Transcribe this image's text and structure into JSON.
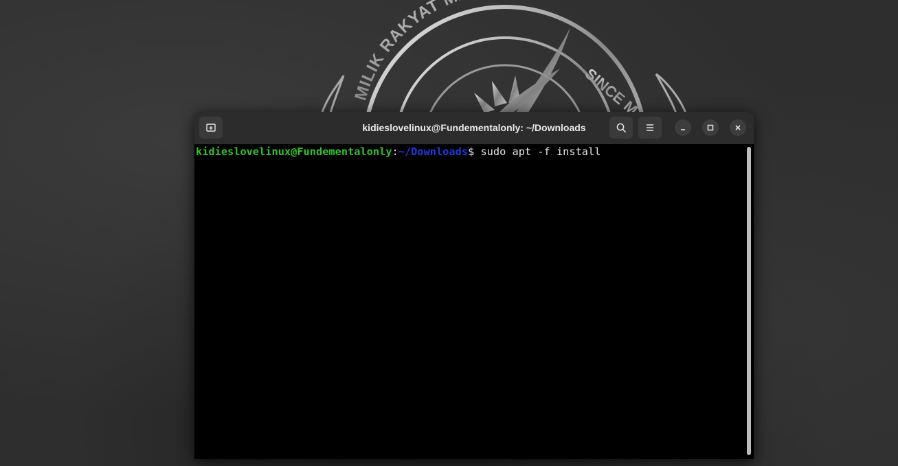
{
  "wallpaper": {
    "emblem_text_left": "MILIK RAKYAT MALAYSIA",
    "emblem_text_right": "SINCE M"
  },
  "window": {
    "title": "kidieslovelinux@Fundementalonly: ~/Downloads",
    "buttons": {
      "new_tab_icon": "new-tab-icon",
      "search_icon": "search-icon",
      "menu_icon": "hamburger-menu-icon",
      "minimize_icon": "minimize-icon",
      "maximize_icon": "maximize-icon",
      "close_icon": "close-icon"
    }
  },
  "terminal": {
    "prompt_user": "kidieslovelinux@Fundementalonly",
    "prompt_colon": ":",
    "prompt_path": "~/Downloads",
    "prompt_dollar": "$",
    "command": " sudo apt -f install"
  },
  "colors": {
    "prompt_user": "#33c12c",
    "prompt_path": "#1f38e3",
    "terminal_bg": "#000000",
    "headerbar_bg": "#2c2c2c"
  }
}
